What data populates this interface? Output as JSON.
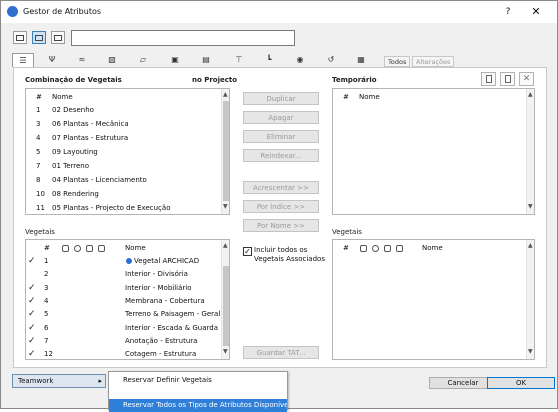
{
  "window": {
    "title": "Gestor de Atributos",
    "help": "?",
    "close": "✕"
  },
  "search": {
    "value": ""
  },
  "tabs": {
    "icons": [
      "layer-combination-icon",
      "pen-icon",
      "line-type-icon",
      "fill-icon",
      "composite-icon",
      "profile-icon",
      "building-material-icon",
      "surface-icon",
      "zone-category-icon",
      "location-icon",
      "mep-icon",
      "markup-icon"
    ],
    "todos": "Todos",
    "alteracoes": "Alterações"
  },
  "left_top": {
    "title": "Combinação de Vegetais",
    "header_right": "no Projecto",
    "col_num": "#",
    "col_name": "Nome",
    "rows": [
      {
        "n": "1",
        "name": "02 Desenho"
      },
      {
        "n": "3",
        "name": "06 Plantas - Mecânica"
      },
      {
        "n": "4",
        "name": "07 Plantas - Estrutura"
      },
      {
        "n": "5",
        "name": "09 Layouting"
      },
      {
        "n": "7",
        "name": "01 Terreno"
      },
      {
        "n": "8",
        "name": "04 Plantas - Licenciamento"
      },
      {
        "n": "10",
        "name": "08 Rendering"
      },
      {
        "n": "11",
        "name": "05 Plantas - Projecto de Execução"
      }
    ]
  },
  "buttons": {
    "duplicar": "Duplicar",
    "apagar": "Apagar",
    "eliminar": "Eliminar",
    "reindexar": "Reindexar...",
    "acrescentar": "Acrescentar >>",
    "por_indice": "Por Índice >>",
    "por_nome": "Por Nome >>",
    "guardar": "Guardar TAT..."
  },
  "include_checkbox": {
    "label": "Incluir todos os Vegetais Associados",
    "checked": true
  },
  "right_top": {
    "title": "Temporário",
    "col_num": "#",
    "col_name": "Nome"
  },
  "left_bottom": {
    "title": "Vegetais",
    "col_num": "#",
    "col_name": "Nome",
    "rows": [
      {
        "n": "1",
        "name": "Vegetal ARCHICAD",
        "checked": true,
        "globe": true
      },
      {
        "n": "2",
        "name": "Interior - Divisória",
        "checked": false
      },
      {
        "n": "3",
        "name": "Interior - Mobiliário",
        "checked": true
      },
      {
        "n": "4",
        "name": "Membrana - Cobertura",
        "checked": true
      },
      {
        "n": "5",
        "name": "Terreno & Paisagem - Geral",
        "checked": true
      },
      {
        "n": "6",
        "name": "Interior - Escada & Guarda",
        "checked": true
      },
      {
        "n": "7",
        "name": "Anotação - Estrutura",
        "checked": true
      },
      {
        "n": "12",
        "name": "Cotagem - Estrutura",
        "checked": true
      }
    ]
  },
  "right_bottom": {
    "title": "Vegetais",
    "col_num": "#",
    "col_name": "Nome"
  },
  "footer": {
    "teamwork": "Teamwork",
    "menu_items": [
      "Reservar Definir Vegetais",
      "Reservar Todos os Tipos de Atributos Disponíveis"
    ],
    "cancel": "Cancelar",
    "ok": "OK"
  }
}
